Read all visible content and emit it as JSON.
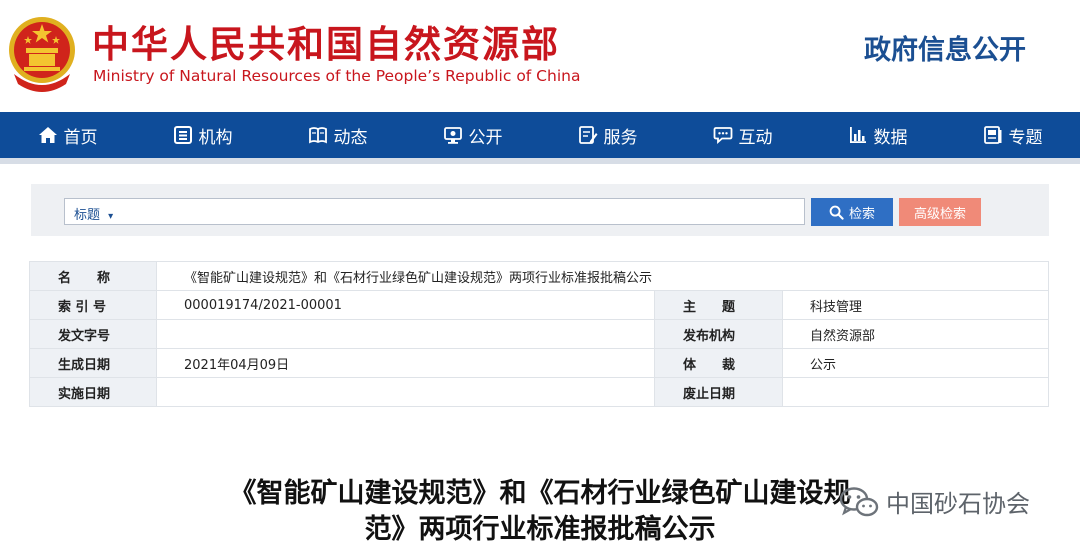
{
  "header": {
    "title_cn": "中华人民共和国自然资源部",
    "title_en": "Ministry of Natural Resources of the People’s Republic of China",
    "gov_info": "政府信息公开"
  },
  "nav": {
    "items": [
      {
        "label": "首页",
        "icon": "home-icon"
      },
      {
        "label": "机构",
        "icon": "org-icon"
      },
      {
        "label": "动态",
        "icon": "book-icon"
      },
      {
        "label": "公开",
        "icon": "monitor-icon"
      },
      {
        "label": "服务",
        "icon": "edit-icon"
      },
      {
        "label": "互动",
        "icon": "chat-icon"
      },
      {
        "label": "数据",
        "icon": "bar-chart-icon"
      },
      {
        "label": "专题",
        "icon": "topic-icon"
      }
    ]
  },
  "search": {
    "type_label": "标题",
    "type_caret": "▾",
    "search_label": "检索",
    "advanced_label": "高级检索"
  },
  "meta": {
    "name_key": "名　　称",
    "name_value": "《智能矿山建设规范》和《石材行业绿色矿山建设规范》两项行业标准报批稿公示",
    "index_key": "索 引 号",
    "index_value": "000019174/2021-00001",
    "subject_key": "主　　题",
    "subject_value": "科技管理",
    "docno_key": "发文字号",
    "docno_value": "",
    "agency_key": "发布机构",
    "agency_value": "自然资源部",
    "created_key": "生成日期",
    "created_value": "2021年04月09日",
    "genre_key": "体　　裁",
    "genre_value": "公示",
    "effective_key": "实施日期",
    "effective_value": "",
    "expiry_key": "废止日期",
    "expiry_value": ""
  },
  "article": {
    "title_line1": "《智能矿山建设规范》和《石材行业绿色矿山建设规",
    "title_line2": "范》两项行业标准报批稿公示"
  },
  "watermark": {
    "text": "中国砂石协会"
  },
  "colors": {
    "brand_red": "#c8161d",
    "nav_blue": "#0e4c99",
    "search_blue": "#2f6fc4",
    "advanced_salmon": "#f08a78"
  }
}
